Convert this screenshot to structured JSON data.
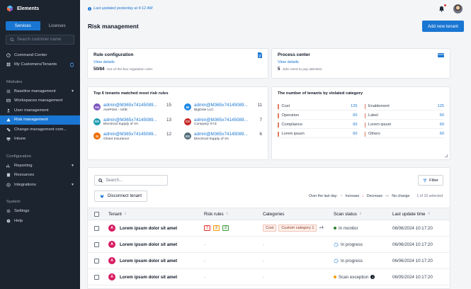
{
  "app": {
    "name": "Elements"
  },
  "sidebar": {
    "tabs": [
      {
        "label": "Services",
        "active": true
      },
      {
        "label": "Licenses",
        "active": false
      }
    ],
    "search_placeholder": "Search customer name",
    "top_items": [
      {
        "label": "Command Center",
        "icon": "gauge-icon"
      },
      {
        "label": "My Customers/Tenants",
        "icon": "grid-icon",
        "badge_icon": "sync-icon"
      }
    ],
    "modules_title": "Modules",
    "modules": [
      {
        "label": "Baseline management",
        "icon": "list-icon",
        "caret": true
      },
      {
        "label": "Workspaces management",
        "icon": "workspace-icon"
      },
      {
        "label": "User management",
        "icon": "user-icon"
      },
      {
        "label": "Risk management",
        "icon": "warning-icon",
        "active": true
      },
      {
        "label": "Change management com...",
        "icon": "change-icon"
      },
      {
        "label": "Intune",
        "icon": "intune-icon"
      }
    ],
    "configuration_title": "Configuration",
    "configuration": [
      {
        "label": "Reporting",
        "icon": "chart-icon",
        "caret": true
      },
      {
        "label": "Resources",
        "icon": "resources-icon"
      },
      {
        "label": "Integrations",
        "icon": "integrations-icon",
        "caret": true
      }
    ],
    "system_title": "System",
    "system": [
      {
        "label": "Settings",
        "icon": "gear-icon"
      },
      {
        "label": "Help",
        "icon": "help-icon"
      }
    ]
  },
  "topbar": {
    "last_updated": "Last updated yesterday at 4:12 AM"
  },
  "page": {
    "title": "Risk management",
    "add_button": "Add new tenant"
  },
  "rule_config": {
    "title": "Rule configuration",
    "link": "View details",
    "count": "50/84",
    "note": "Out-of-the-box regulation rules"
  },
  "process_center": {
    "title": "Process center",
    "link": "View details",
    "count": "5",
    "note": "Jobs need to pay attention"
  },
  "top_tenants": {
    "title": "Top 6 tenants matched most risk rules",
    "items": [
      {
        "initials": "AU",
        "color": "#7e57c2",
        "name": "admin@M365x74145089...",
        "org": "AvePoint - UDE",
        "count": "15"
      },
      {
        "initials": "BI",
        "color": "#1e88e5",
        "name": "admin@M365x74145089...",
        "org": "BigDote LLC",
        "count": "11"
      },
      {
        "initials": "ES",
        "color": "#1e9bb0",
        "name": "admin@M365x74145089...",
        "org": "Electrical Supply of VA",
        "count": "13"
      },
      {
        "initials": "CX",
        "color": "#c62828",
        "name": "admin@M365x74145089...",
        "org": "Company XYZ",
        "count": "7"
      },
      {
        "initials": "GI",
        "color": "#ef6c00",
        "name": "admin@M365x74145089...",
        "org": "Ghant Insurance",
        "count": "12"
      },
      {
        "initials": "ES",
        "color": "#546e7a",
        "name": "admin@M365x74145089...",
        "org": "Electrical Supply of VA",
        "count": "6"
      }
    ]
  },
  "violated": {
    "title": "The number of tenants by violated category",
    "items": [
      {
        "label": "Cost",
        "value": "125"
      },
      {
        "label": "Enablement",
        "value": "125"
      },
      {
        "label": "Operation",
        "value": "60"
      },
      {
        "label": "Label",
        "value": "60"
      },
      {
        "label": "Compliance",
        "value": "60"
      },
      {
        "label": "Lorem ipsum",
        "value": "60"
      },
      {
        "label": "Lorem ipsum",
        "value": "60"
      },
      {
        "label": "Others",
        "value": "60"
      }
    ]
  },
  "table": {
    "search_placeholder": "Search...",
    "filter_label": "Filter",
    "disconnect_label": "Disconnect tenant",
    "legend": {
      "prefix": "Over the last day:",
      "increase": "Increase",
      "decrease": "Decrease",
      "nochange": "No change",
      "selected": "1 of 10 selected"
    },
    "columns": [
      "Tenant",
      "Risk rules",
      "Categories",
      "Scan status",
      "Last update time"
    ],
    "rows": [
      {
        "avatar": "A",
        "tenant": "Lorem ipsum dolor sit amet",
        "risk": [
          "7",
          "2",
          "2"
        ],
        "categories": [
          "Cost",
          "Custom category 1"
        ],
        "more": "+4",
        "status": "In monitor",
        "status_type": "monitor",
        "time": "06/06/2024 10:17:20"
      },
      {
        "avatar": "A",
        "tenant": "Lorem ipsum dolor sit amet",
        "risk_text": "-",
        "categories_text": "-",
        "status": "In progress",
        "status_type": "progress",
        "time": "06/06/2024 10:17:20"
      },
      {
        "avatar": "A",
        "tenant": "Lorem ipsum dolor sit amet",
        "risk_text": "-",
        "categories_text": "-",
        "status": "In progress",
        "status_type": "progress",
        "time": "06/06/2024 10:17:20"
      },
      {
        "avatar": "A",
        "tenant": "Lorem ipsum dolor sit amet",
        "risk_text": "-",
        "categories_text": "-",
        "status": "Scan exception",
        "status_type": "exception",
        "time": "06/05/2024 10:17:20"
      }
    ]
  },
  "colors": {
    "accent": "#1976d2",
    "sidebar": "#1c2430",
    "active_item": "#1976d2",
    "avatar": "#d81b60"
  }
}
